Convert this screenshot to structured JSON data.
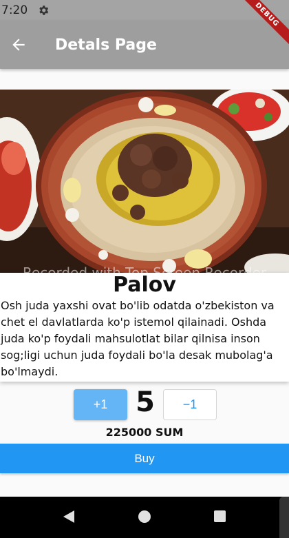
{
  "status_bar": {
    "time": "7:20"
  },
  "app_bar": {
    "title": "Detals Page"
  },
  "debug_banner": {
    "label": "DEBUG"
  },
  "watermark": {
    "text": "Recorded with Top Screen Recorder"
  },
  "dish": {
    "name": "Palov",
    "description": "Osh juda yaxshi ovat bo'lib odatda o'zbekiston va chet el davlatlarda ko'p istemol qilainadi. Oshda juda ko'p foydali mahsulotlat bilar qilnisa inson sog;ligi uchun juda foydali bo'la desak mubolag'a bo'lmaydi."
  },
  "quantity": {
    "plus_label": "+1",
    "value": "5",
    "minus_label": "−1"
  },
  "price": {
    "text": "225000 SUM"
  },
  "buy_button": {
    "label": "Buy"
  },
  "colors": {
    "primary": "#2196f3",
    "primary_light": "#64b5f6",
    "app_bar": "#9e9e9e"
  }
}
